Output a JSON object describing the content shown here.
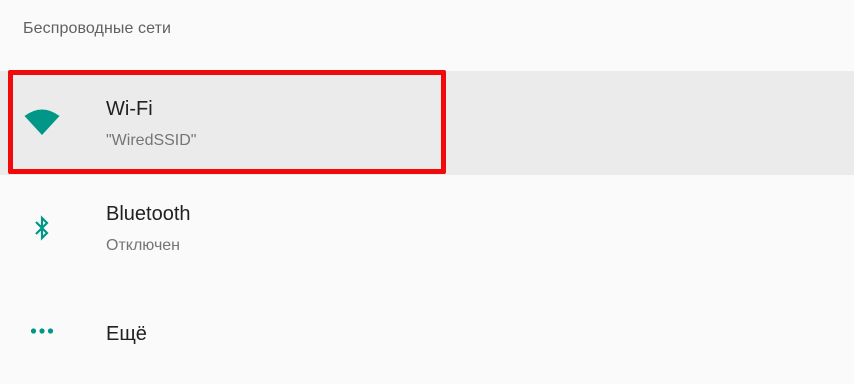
{
  "section": {
    "title": "Беспроводные сети"
  },
  "items": [
    {
      "title": "Wi-Fi",
      "summary": "\"WiredSSID\"",
      "icon": "wifi-icon"
    },
    {
      "title": "Bluetooth",
      "summary": "Отключен",
      "icon": "bluetooth-icon"
    },
    {
      "title": "Ещё",
      "icon": "more-horiz-icon"
    }
  ],
  "colors": {
    "accent": "#009688",
    "highlight": "#f20a0a",
    "selected_bg": "#ebebeb",
    "background": "#fafafa"
  }
}
